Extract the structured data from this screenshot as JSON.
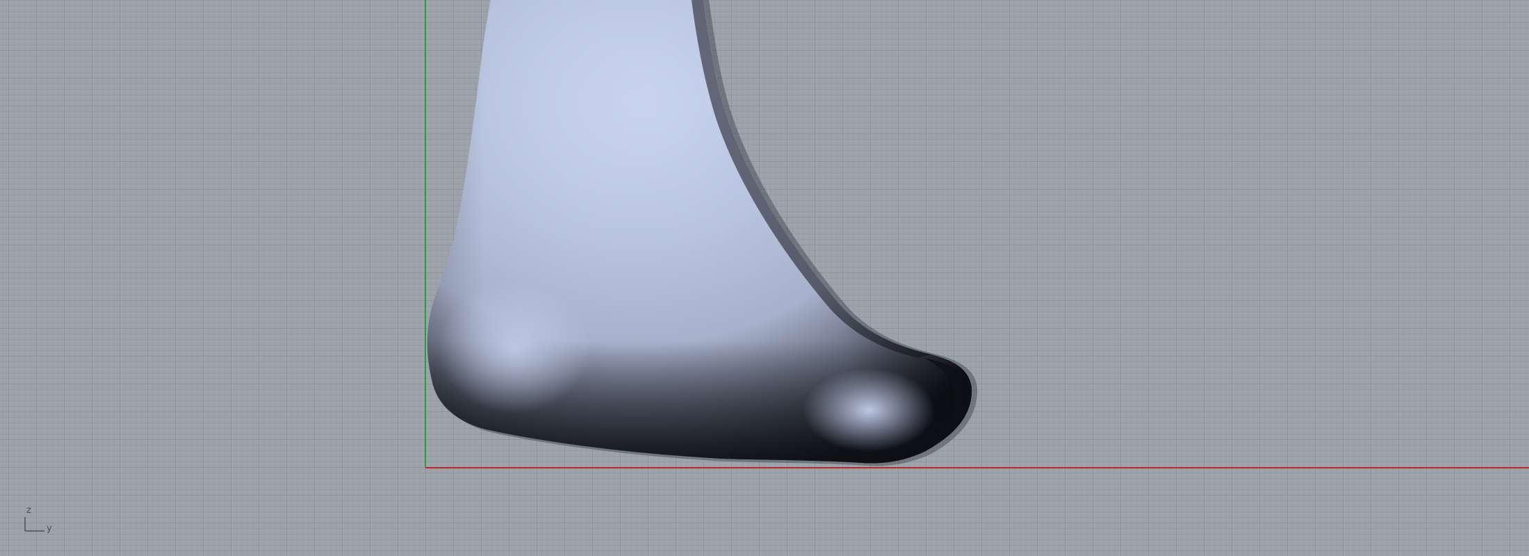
{
  "viewport": {
    "background_color": "#9da3aa",
    "grid_minor_color": "#8f959c",
    "grid_major_color": "#7f858c",
    "x_axis_color": "#b4282d",
    "z_axis_color": "#2f9a3a"
  },
  "model": {
    "surface_light": "#c8d3ee",
    "surface_mid": "#a9b3cc",
    "surface_dark": "#1a1d26"
  },
  "axis_triad": {
    "vertical_label": "z",
    "horizontal_label": "y",
    "icon": "axis-triad-icon"
  }
}
